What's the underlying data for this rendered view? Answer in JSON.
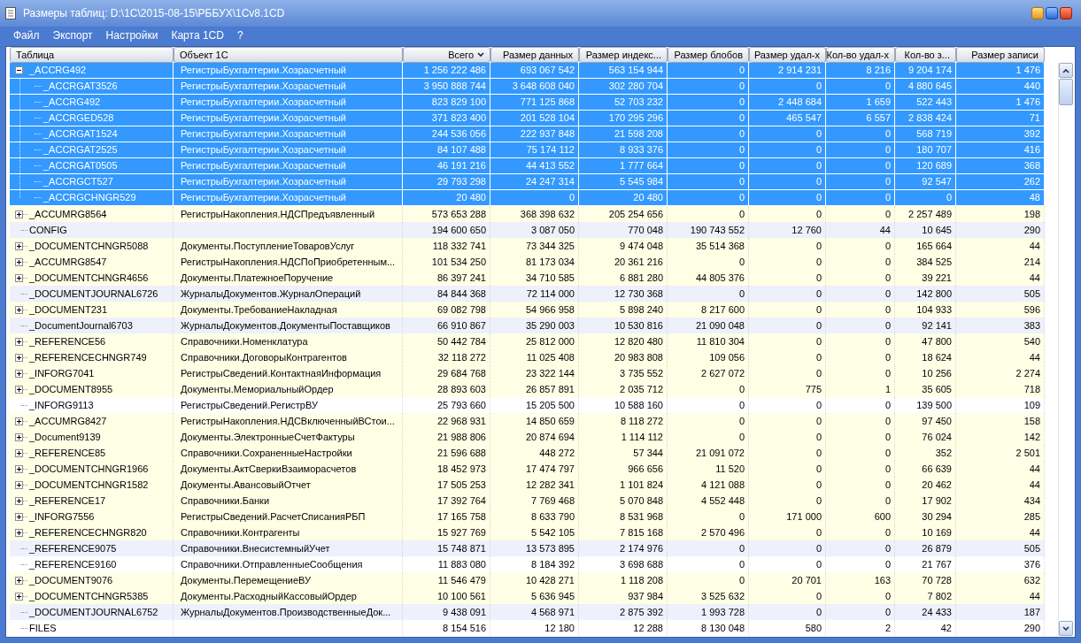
{
  "window": {
    "title": "Размеры таблиц: D:\\1C\\2015-08-15\\РББУХ\\1Cv8.1CD"
  },
  "menu": [
    "Файл",
    "Экспорт",
    "Настройки",
    "Карта 1CD",
    "?"
  ],
  "columns": [
    {
      "label": "Таблица",
      "sorted": false
    },
    {
      "label": "Объект 1С",
      "sorted": false
    },
    {
      "label": "Всего",
      "sorted": true
    },
    {
      "label": "Размер данных",
      "sorted": false
    },
    {
      "label": "Размер индекс...",
      "sorted": false
    },
    {
      "label": "Размер блобов",
      "sorted": false
    },
    {
      "label": "Размер удал-х",
      "sorted": false
    },
    {
      "label": "Кол-во удал-х",
      "sorted": false
    },
    {
      "label": "Кол-во з...",
      "sorted": false
    },
    {
      "label": "Размер записи",
      "sorted": false
    }
  ],
  "rows": [
    {
      "table": "_ACCRG492",
      "object": "РегистрыБухгалтерии.Хозрасчетный",
      "cells": [
        "1 256 222 486",
        "693 067 542",
        "563 154 944",
        "0",
        "2 914 231",
        "8 216",
        "9 204 174",
        "1 476"
      ],
      "selected": true,
      "expanded": true,
      "children": [
        {
          "table": "_ACCRGAT3526",
          "object": "РегистрыБухгалтерии.Хозрасчетный",
          "cells": [
            "3 950 888 744",
            "3 648 608 040",
            "302 280 704",
            "0",
            "0",
            "0",
            "4 880 645",
            "440"
          ],
          "selected": true
        },
        {
          "table": "_ACCRG492",
          "object": "РегистрыБухгалтерии.Хозрасчетный",
          "cells": [
            "823 829 100",
            "771 125 868",
            "52 703 232",
            "0",
            "2 448 684",
            "1 659",
            "522 443",
            "1 476"
          ],
          "selected": true
        },
        {
          "table": "_ACCRGED528",
          "object": "РегистрыБухгалтерии.Хозрасчетный",
          "cells": [
            "371 823 400",
            "201 528 104",
            "170 295 296",
            "0",
            "465 547",
            "6 557",
            "2 838 424",
            "71"
          ],
          "selected": true
        },
        {
          "table": "_ACCRGAT1524",
          "object": "РегистрыБухгалтерии.Хозрасчетный",
          "cells": [
            "244 536 056",
            "222 937 848",
            "21 598 208",
            "0",
            "0",
            "0",
            "568 719",
            "392"
          ],
          "selected": true
        },
        {
          "table": "_ACCRGAT2525",
          "object": "РегистрыБухгалтерии.Хозрасчетный",
          "cells": [
            "84 107 488",
            "75 174 112",
            "8 933 376",
            "0",
            "0",
            "0",
            "180 707",
            "416"
          ],
          "selected": true
        },
        {
          "table": "_ACCRGAT0505",
          "object": "РегистрыБухгалтерии.Хозрасчетный",
          "cells": [
            "46 191 216",
            "44 413 552",
            "1 777 664",
            "0",
            "0",
            "0",
            "120 689",
            "368"
          ],
          "selected": true
        },
        {
          "table": "_ACCRGCT527",
          "object": "РегистрыБухгалтерии.Хозрасчетный",
          "cells": [
            "29 793 298",
            "24 247 314",
            "5 545 984",
            "0",
            "0",
            "0",
            "92 547",
            "262"
          ],
          "selected": true
        },
        {
          "table": "_ACCRGCHNGR529",
          "object": "РегистрыБухгалтерии.Хозрасчетный",
          "cells": [
            "20 480",
            "0",
            "20 480",
            "0",
            "0",
            "0",
            "0",
            "48"
          ],
          "selected": true
        }
      ]
    },
    {
      "table": "_ACCUMRG8564",
      "object": "РегистрыНакопления.НДСПредъявленный",
      "cells": [
        "573 653 288",
        "368 398 632",
        "205 254 656",
        "0",
        "0",
        "0",
        "2 257 489",
        "198"
      ],
      "selected": false,
      "expanded": false,
      "color": "#ffffe6"
    },
    {
      "table": "CONFIG",
      "cells": [
        "194 600 650",
        "3 087 050",
        "770 048",
        "190 743 552",
        "12 760",
        "44",
        "10 645",
        "290"
      ],
      "selected": false,
      "color": "#eef0fb"
    },
    {
      "table": "_DOCUMENTCHNGR5088",
      "object": "Документы.ПоступлениеТоваровУслуг",
      "cells": [
        "118 332 741",
        "73 344 325",
        "9 474 048",
        "35 514 368",
        "0",
        "0",
        "165 664",
        "44"
      ],
      "selected": false,
      "expanded": false,
      "color": "#ffffe6"
    },
    {
      "table": "_ACCUMRG8547",
      "object": "РегистрыНакопления.НДСПоПриобретенным...",
      "cells": [
        "101 534 250",
        "81 173 034",
        "20 361 216",
        "0",
        "0",
        "0",
        "384 525",
        "214"
      ],
      "selected": false,
      "expanded": false,
      "color": "#ffffe6"
    },
    {
      "table": "_DOCUMENTCHNGR4656",
      "object": "Документы.ПлатежноеПоручение",
      "cells": [
        "86 397 241",
        "34 710 585",
        "6 881 280",
        "44 805 376",
        "0",
        "0",
        "39 221",
        "44"
      ],
      "selected": false,
      "expanded": false,
      "color": "#ffffe6"
    },
    {
      "table": "_DOCUMENTJOURNAL6726",
      "object": "ЖурналыДокументов.ЖурналОпераций",
      "cells": [
        "84 844 368",
        "72 114 000",
        "12 730 368",
        "0",
        "0",
        "0",
        "142 800",
        "505"
      ],
      "selected": false,
      "color": "#eef0fb"
    },
    {
      "table": "_DOCUMENT231",
      "object": "Документы.ТребованиеНакладная",
      "cells": [
        "69 082 798",
        "54 966 958",
        "5 898 240",
        "8 217 600",
        "0",
        "0",
        "104 933",
        "596"
      ],
      "selected": false,
      "expanded": false,
      "color": "#ffffe6"
    },
    {
      "table": "_DocumentJournal6703",
      "object": "ЖурналыДокументов.ДокументыПоставщиков",
      "cells": [
        "66 910 867",
        "35 290 003",
        "10 530 816",
        "21 090 048",
        "0",
        "0",
        "92 141",
        "383"
      ],
      "selected": false,
      "color": "#eef0fb"
    },
    {
      "table": "_REFERENCE56",
      "object": "Справочники.Номенклатура",
      "cells": [
        "50 442 784",
        "25 812 000",
        "12 820 480",
        "11 810 304",
        "0",
        "0",
        "47 800",
        "540"
      ],
      "selected": false,
      "expanded": false,
      "color": "#ffffe6"
    },
    {
      "table": "_REFERENCECHNGR749",
      "object": "Справочники.ДоговорыКонтрагентов",
      "cells": [
        "32 118 272",
        "11 025 408",
        "20 983 808",
        "109 056",
        "0",
        "0",
        "18 624",
        "44"
      ],
      "selected": false,
      "expanded": false,
      "color": "#ffffe6"
    },
    {
      "table": "_INFORG7041",
      "object": "РегистрыСведений.КонтактнаяИнформация",
      "cells": [
        "29 684 768",
        "23 322 144",
        "3 735 552",
        "2 627 072",
        "0",
        "0",
        "10 256",
        "2 274"
      ],
      "selected": false,
      "expanded": false,
      "color": "#ffffe6"
    },
    {
      "table": "_DOCUMENT8955",
      "object": "Документы.МемориальныйОрдер",
      "cells": [
        "28 893 603",
        "26 857 891",
        "2 035 712",
        "0",
        "775",
        "1",
        "35 605",
        "718"
      ],
      "selected": false,
      "expanded": false,
      "color": "#ffffe6"
    },
    {
      "table": "_INFORG9113",
      "object": "РегистрыСведений.РегистрВУ",
      "cells": [
        "25 793 660",
        "15 205 500",
        "10 588 160",
        "0",
        "0",
        "0",
        "139 500",
        "109"
      ],
      "selected": false,
      "color": "#ffffff"
    },
    {
      "table": "_ACCUMRG8427",
      "object": "РегистрыНакопления.НДСВключенныйВСтои...",
      "cells": [
        "22 968 931",
        "14 850 659",
        "8 118 272",
        "0",
        "0",
        "0",
        "97 450",
        "158"
      ],
      "selected": false,
      "expanded": false,
      "color": "#ffffe6"
    },
    {
      "table": "_Document9139",
      "object": "Документы.ЭлектронныеСчетФактуры",
      "cells": [
        "21 988 806",
        "20 874 694",
        "1 114 112",
        "0",
        "0",
        "0",
        "76 024",
        "142"
      ],
      "selected": false,
      "expanded": false,
      "color": "#ffffe6"
    },
    {
      "table": "_REFERENCE85",
      "object": "Справочники.СохраненныеНастройки",
      "cells": [
        "21 596 688",
        "448 272",
        "57 344",
        "21 091 072",
        "0",
        "0",
        "352",
        "2 501"
      ],
      "selected": false,
      "expanded": false,
      "color": "#ffffe6"
    },
    {
      "table": "_DOCUMENTCHNGR1966",
      "object": "Документы.АктСверкиВзаиморасчетов",
      "cells": [
        "18 452 973",
        "17 474 797",
        "966 656",
        "11 520",
        "0",
        "0",
        "66 639",
        "44"
      ],
      "selected": false,
      "expanded": false,
      "color": "#ffffe6"
    },
    {
      "table": "_DOCUMENTCHNGR1582",
      "object": "Документы.АвансовыйОтчет",
      "cells": [
        "17 505 253",
        "12 282 341",
        "1 101 824",
        "4 121 088",
        "0",
        "0",
        "20 462",
        "44"
      ],
      "selected": false,
      "expanded": false,
      "color": "#ffffe6"
    },
    {
      "table": "_REFERENCE17",
      "object": "Справочники.Банки",
      "cells": [
        "17 392 764",
        "7 769 468",
        "5 070 848",
        "4 552 448",
        "0",
        "0",
        "17 902",
        "434"
      ],
      "selected": false,
      "expanded": false,
      "color": "#ffffe6"
    },
    {
      "table": "_INFORG7556",
      "object": "РегистрыСведений.РасчетСписанияРБП",
      "cells": [
        "17 165 758",
        "8 633 790",
        "8 531 968",
        "0",
        "171 000",
        "600",
        "30 294",
        "285"
      ],
      "selected": false,
      "expanded": false,
      "color": "#ffffe6"
    },
    {
      "table": "_REFERENCECHNGR820",
      "object": "Справочники.Контрагенты",
      "cells": [
        "15 927 769",
        "5 542 105",
        "7 815 168",
        "2 570 496",
        "0",
        "0",
        "10 169",
        "44"
      ],
      "selected": false,
      "expanded": false,
      "color": "#ffffe6"
    },
    {
      "table": "_REFERENCE9075",
      "object": "Справочники.ВнесистемныйУчет",
      "cells": [
        "15 748 871",
        "13 573 895",
        "2 174 976",
        "0",
        "0",
        "0",
        "26 879",
        "505"
      ],
      "selected": false,
      "color": "#eef0fb"
    },
    {
      "table": "_REFERENCE9160",
      "object": "Справочники.ОтправленныеСообщения",
      "cells": [
        "11 883 080",
        "8 184 392",
        "3 698 688",
        "0",
        "0",
        "0",
        "21 767",
        "376"
      ],
      "selected": false,
      "color": "#ffffff"
    },
    {
      "table": "_DOCUMENT9076",
      "object": "Документы.ПеремещениеВУ",
      "cells": [
        "11 546 479",
        "10 428 271",
        "1 118 208",
        "0",
        "20 701",
        "163",
        "70 728",
        "632"
      ],
      "selected": false,
      "expanded": false,
      "color": "#ffffe6"
    },
    {
      "table": "_DOCUMENTCHNGR5385",
      "object": "Документы.РасходныйКассовыйОрдер",
      "cells": [
        "10 100 561",
        "5 636 945",
        "937 984",
        "3 525 632",
        "0",
        "0",
        "7 802",
        "44"
      ],
      "selected": false,
      "expanded": false,
      "color": "#ffffe6"
    },
    {
      "table": "_DOCUMENTJOURNAL6752",
      "object": "ЖурналыДокументов.ПроизводственныеДок...",
      "cells": [
        "9 438 091",
        "4 568 971",
        "2 875 392",
        "1 993 728",
        "0",
        "0",
        "24 433",
        "187"
      ],
      "selected": false,
      "color": "#eef0fb"
    },
    {
      "table": "FILES",
      "cells": [
        "8 154 516",
        "12 180",
        "12 288",
        "8 130 048",
        "580",
        "2",
        "42",
        "290"
      ],
      "selected": false,
      "color": "#ffffff"
    }
  ]
}
